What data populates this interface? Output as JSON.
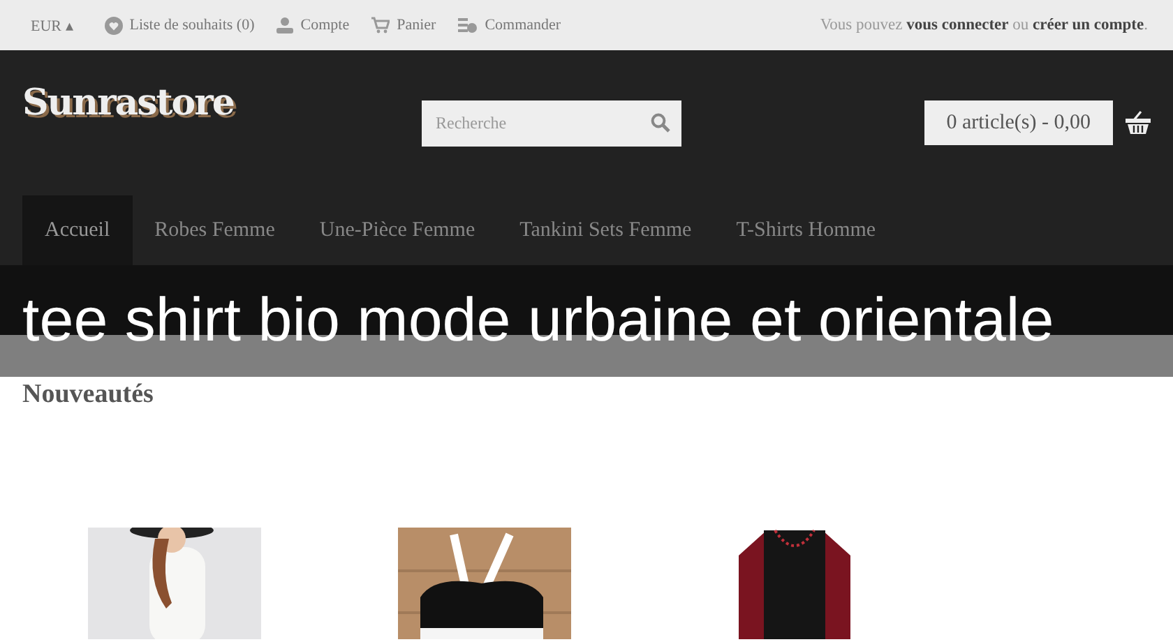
{
  "top_bar": {
    "currency": "EUR ▴",
    "links": [
      {
        "label": "Liste de souhaits (0)"
      },
      {
        "label": "Compte"
      },
      {
        "label": "Panier"
      },
      {
        "label": "Commander"
      }
    ],
    "login_text": "Vous pouvez **vous connecter** ou **créer un compte**."
  },
  "header": {
    "logo": "Sunrastore",
    "search": {
      "placeholder": "Recherche"
    },
    "cart": "0 article(s) - 0,00"
  },
  "nav": [
    {
      "label": "Accueil",
      "selected": true
    },
    {
      "label": "Robes Femme",
      "selected": false
    },
    {
      "label": "Une-Pièce Femme",
      "selected": false
    },
    {
      "label": "Tankini Sets Femme",
      "selected": false
    },
    {
      "label": "T-Shirts Homme",
      "selected": false
    }
  ],
  "overlay_title": "tee shirt bio mode urbaine et orientale",
  "section_title": "Nouveautés"
}
